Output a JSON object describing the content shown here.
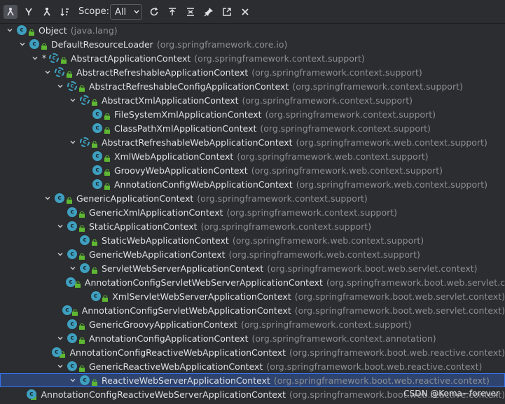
{
  "toolbar": {
    "scope_label": "Scope:",
    "scope_value": "All"
  },
  "tree": [
    {
      "name": "Object",
      "pkg": "(java.lang)",
      "depth": 0,
      "expanded": true,
      "abstract": false
    },
    {
      "name": "DefaultResourceLoader",
      "pkg": "(org.springframework.core.io)",
      "depth": 1,
      "expanded": true,
      "abstract": false
    },
    {
      "name": "AbstractApplicationContext",
      "pkg": "(org.springframework.context.support)",
      "depth": 2,
      "expanded": true,
      "abstract": true,
      "star": true
    },
    {
      "name": "AbstractRefreshableApplicationContext",
      "pkg": "(org.springframework.context.support)",
      "depth": 3,
      "expanded": true,
      "abstract": true
    },
    {
      "name": "AbstractRefreshableConfigApplicationContext",
      "pkg": "(org.springframework.context.support)",
      "depth": 4,
      "expanded": true,
      "abstract": true
    },
    {
      "name": "AbstractXmlApplicationContext",
      "pkg": "(org.springframework.context.support)",
      "depth": 5,
      "expanded": true,
      "abstract": true
    },
    {
      "name": "FileSystemXmlApplicationContext",
      "pkg": "(org.springframework.context.support)",
      "depth": 6,
      "leaf": true
    },
    {
      "name": "ClassPathXmlApplicationContext",
      "pkg": "(org.springframework.context.support)",
      "depth": 6,
      "leaf": true
    },
    {
      "name": "AbstractRefreshableWebApplicationContext",
      "pkg": "(org.springframework.web.context.support)",
      "depth": 5,
      "expanded": true,
      "abstract": true
    },
    {
      "name": "XmlWebApplicationContext",
      "pkg": "(org.springframework.web.context.support)",
      "depth": 6,
      "leaf": true
    },
    {
      "name": "GroovyWebApplicationContext",
      "pkg": "(org.springframework.web.context.support)",
      "depth": 6,
      "leaf": true
    },
    {
      "name": "AnnotationConfigWebApplicationContext",
      "pkg": "(org.springframework.web.context.support)",
      "depth": 6,
      "leaf": true
    },
    {
      "name": "GenericApplicationContext",
      "pkg": "(org.springframework.context.support)",
      "depth": 3,
      "expanded": true
    },
    {
      "name": "GenericXmlApplicationContext",
      "pkg": "(org.springframework.context.support)",
      "depth": 4,
      "leaf": true
    },
    {
      "name": "StaticApplicationContext",
      "pkg": "(org.springframework.context.support)",
      "depth": 4,
      "expanded": true
    },
    {
      "name": "StaticWebApplicationContext",
      "pkg": "(org.springframework.web.context.support)",
      "depth": 5,
      "leaf": true
    },
    {
      "name": "GenericWebApplicationContext",
      "pkg": "(org.springframework.web.context.support)",
      "depth": 4,
      "expanded": true
    },
    {
      "name": "ServletWebServerApplicationContext",
      "pkg": "(org.springframework.boot.web.servlet.context)",
      "depth": 5,
      "expanded": true
    },
    {
      "name": "AnnotationConfigServletWebServerApplicationContext",
      "pkg": "(org.springframework.boot.web.servlet.c",
      "depth": 6,
      "leaf": true
    },
    {
      "name": "XmlServletWebServerApplicationContext",
      "pkg": "(org.springframework.boot.web.servlet.context)",
      "depth": 6,
      "leaf": true
    },
    {
      "name": "AnnotationConfigServletWebApplicationContext",
      "pkg": "(org.springframework.boot.web.servlet.context)",
      "depth": 5,
      "leaf": true
    },
    {
      "name": "GenericGroovyApplicationContext",
      "pkg": "(org.springframework.context.support)",
      "depth": 4,
      "leaf": true
    },
    {
      "name": "AnnotationConfigApplicationContext",
      "pkg": "(org.springframework.context.annotation)",
      "depth": 4,
      "expanded": true
    },
    {
      "name": "AnnotationConfigReactiveWebApplicationContext",
      "pkg": "(org.springframework.boot.web.reactive.context)",
      "depth": 5,
      "leaf": true
    },
    {
      "name": "GenericReactiveWebApplicationContext",
      "pkg": "(org.springframework.boot.web.reactive.context)",
      "depth": 4,
      "expanded": true
    },
    {
      "name": "ReactiveWebServerApplicationContext",
      "pkg": "(org.springframework.boot.web.reactive.context)",
      "depth": 5,
      "expanded": true,
      "selected": true
    },
    {
      "name": "AnnotationConfigReactiveWebServerApplicationContext",
      "pkg": "(org.springframework.boot.web.reactive.context)",
      "depth": 6,
      "leaf": true
    }
  ],
  "watermark": "CSDN @Koma~forever"
}
